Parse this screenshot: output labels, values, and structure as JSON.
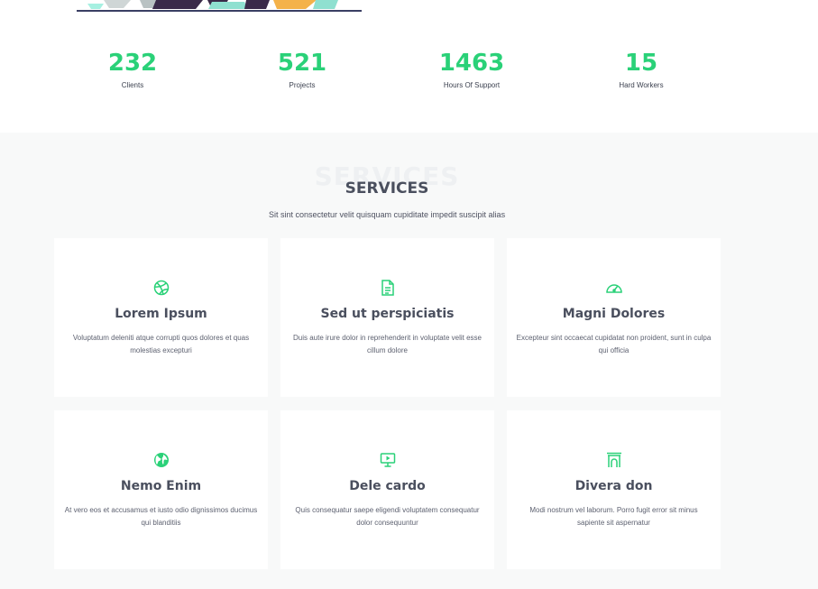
{
  "counters": [
    {
      "value": "232",
      "label": "Clients"
    },
    {
      "value": "521",
      "label": "Projects"
    },
    {
      "value": "1463",
      "label": "Hours Of Support"
    },
    {
      "value": "15",
      "label": "Hard Workers"
    }
  ],
  "services": {
    "title_bg": "SERVICES",
    "title": "SERVICES",
    "subtitle": "Sit sint consectetur velit quisquam cupiditate impedit suscipit alias",
    "items": [
      {
        "icon": "dribbble-icon",
        "title": "Lorem Ipsum",
        "desc": "Voluptatum deleniti atque corrupti quos dolores et quas molestias excepturi"
      },
      {
        "icon": "file-text-icon",
        "title": "Sed ut perspiciatis",
        "desc": "Duis aute irure dolor in reprehenderit in voluptate velit esse cillum dolore"
      },
      {
        "icon": "speedometer-icon",
        "title": "Magni Dolores",
        "desc": "Excepteur sint occaecat cupidatat non proident, sunt in culpa qui officia"
      },
      {
        "icon": "globe-icon",
        "title": "Nemo Enim",
        "desc": "At vero eos et accusamus et iusto odio dignissimos ducimus qui blanditiis"
      },
      {
        "icon": "presentation-icon",
        "title": "Dele cardo",
        "desc": "Quis consequatur saepe eligendi voluptatem consequatur dolor consequuntur"
      },
      {
        "icon": "arch-icon",
        "title": "Divera don",
        "desc": "Modi nostrum vel laborum. Porro fugit error sit minus sapiente sit aspernatur"
      }
    ]
  },
  "colors": {
    "accent": "#2ad178",
    "heading": "#4a4f5e",
    "section_bg": "#f8f9f9"
  }
}
